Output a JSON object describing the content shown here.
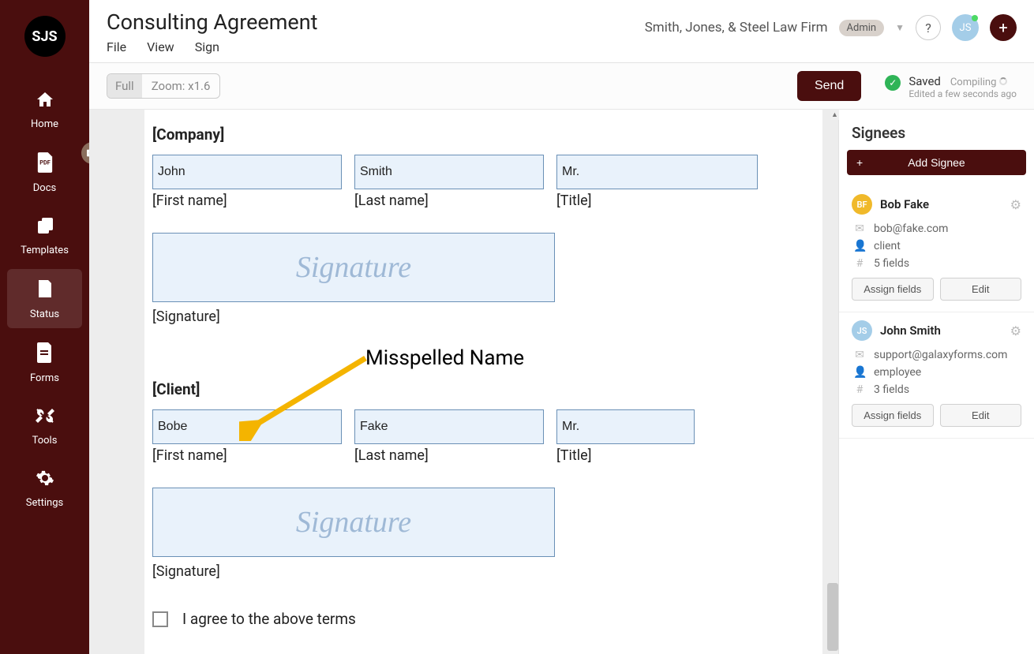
{
  "logo": "SJS",
  "nav": [
    {
      "icon": "home",
      "label": "Home"
    },
    {
      "icon": "pdf",
      "label": "Docs"
    },
    {
      "icon": "copy",
      "label": "Templates"
    },
    {
      "icon": "status",
      "label": "Status"
    },
    {
      "icon": "forms",
      "label": "Forms"
    },
    {
      "icon": "tools",
      "label": "Tools"
    },
    {
      "icon": "settings",
      "label": "Settings"
    }
  ],
  "active_nav_index": 3,
  "header": {
    "title": "Consulting Agreement",
    "menus": [
      "File",
      "View",
      "Sign"
    ],
    "firm": "Smith, Jones, & Steel Law Firm",
    "role_badge": "Admin",
    "user_initials": "JS"
  },
  "toolbar": {
    "zoom_full": "Full",
    "zoom_value": "Zoom: x1.6",
    "send_label": "Send",
    "saved_label": "Saved",
    "compiling_label": "Compiling",
    "edited_label": "Edited a few seconds ago"
  },
  "document": {
    "company_section": "[Company]",
    "client_section": "[Client]",
    "first_name_label": "[First name]",
    "last_name_label": "[Last name]",
    "title_label": "[Title]",
    "signature_label": "[Signature]",
    "signature_placeholder": "Signature",
    "company": {
      "first": "John",
      "last": "Smith",
      "title": "Mr."
    },
    "client": {
      "first": "Bobe",
      "last": "Fake",
      "title": "Mr."
    },
    "agree_label": "I agree to the above terms"
  },
  "annotation": {
    "label": "Misspelled Name"
  },
  "signees_panel": {
    "title": "Signees",
    "add_label": "Add Signee",
    "assign_label": "Assign fields",
    "edit_label": "Edit",
    "signees": [
      {
        "name": "Bob Fake",
        "initials": "BF",
        "color": "#f0b92a",
        "email": "bob@fake.com",
        "role": "client",
        "fields": "5 fields"
      },
      {
        "name": "John Smith",
        "initials": "JS",
        "color": "#a4cde8",
        "email": "support@galaxyforms.com",
        "role": "employee",
        "fields": "3 fields"
      }
    ]
  }
}
